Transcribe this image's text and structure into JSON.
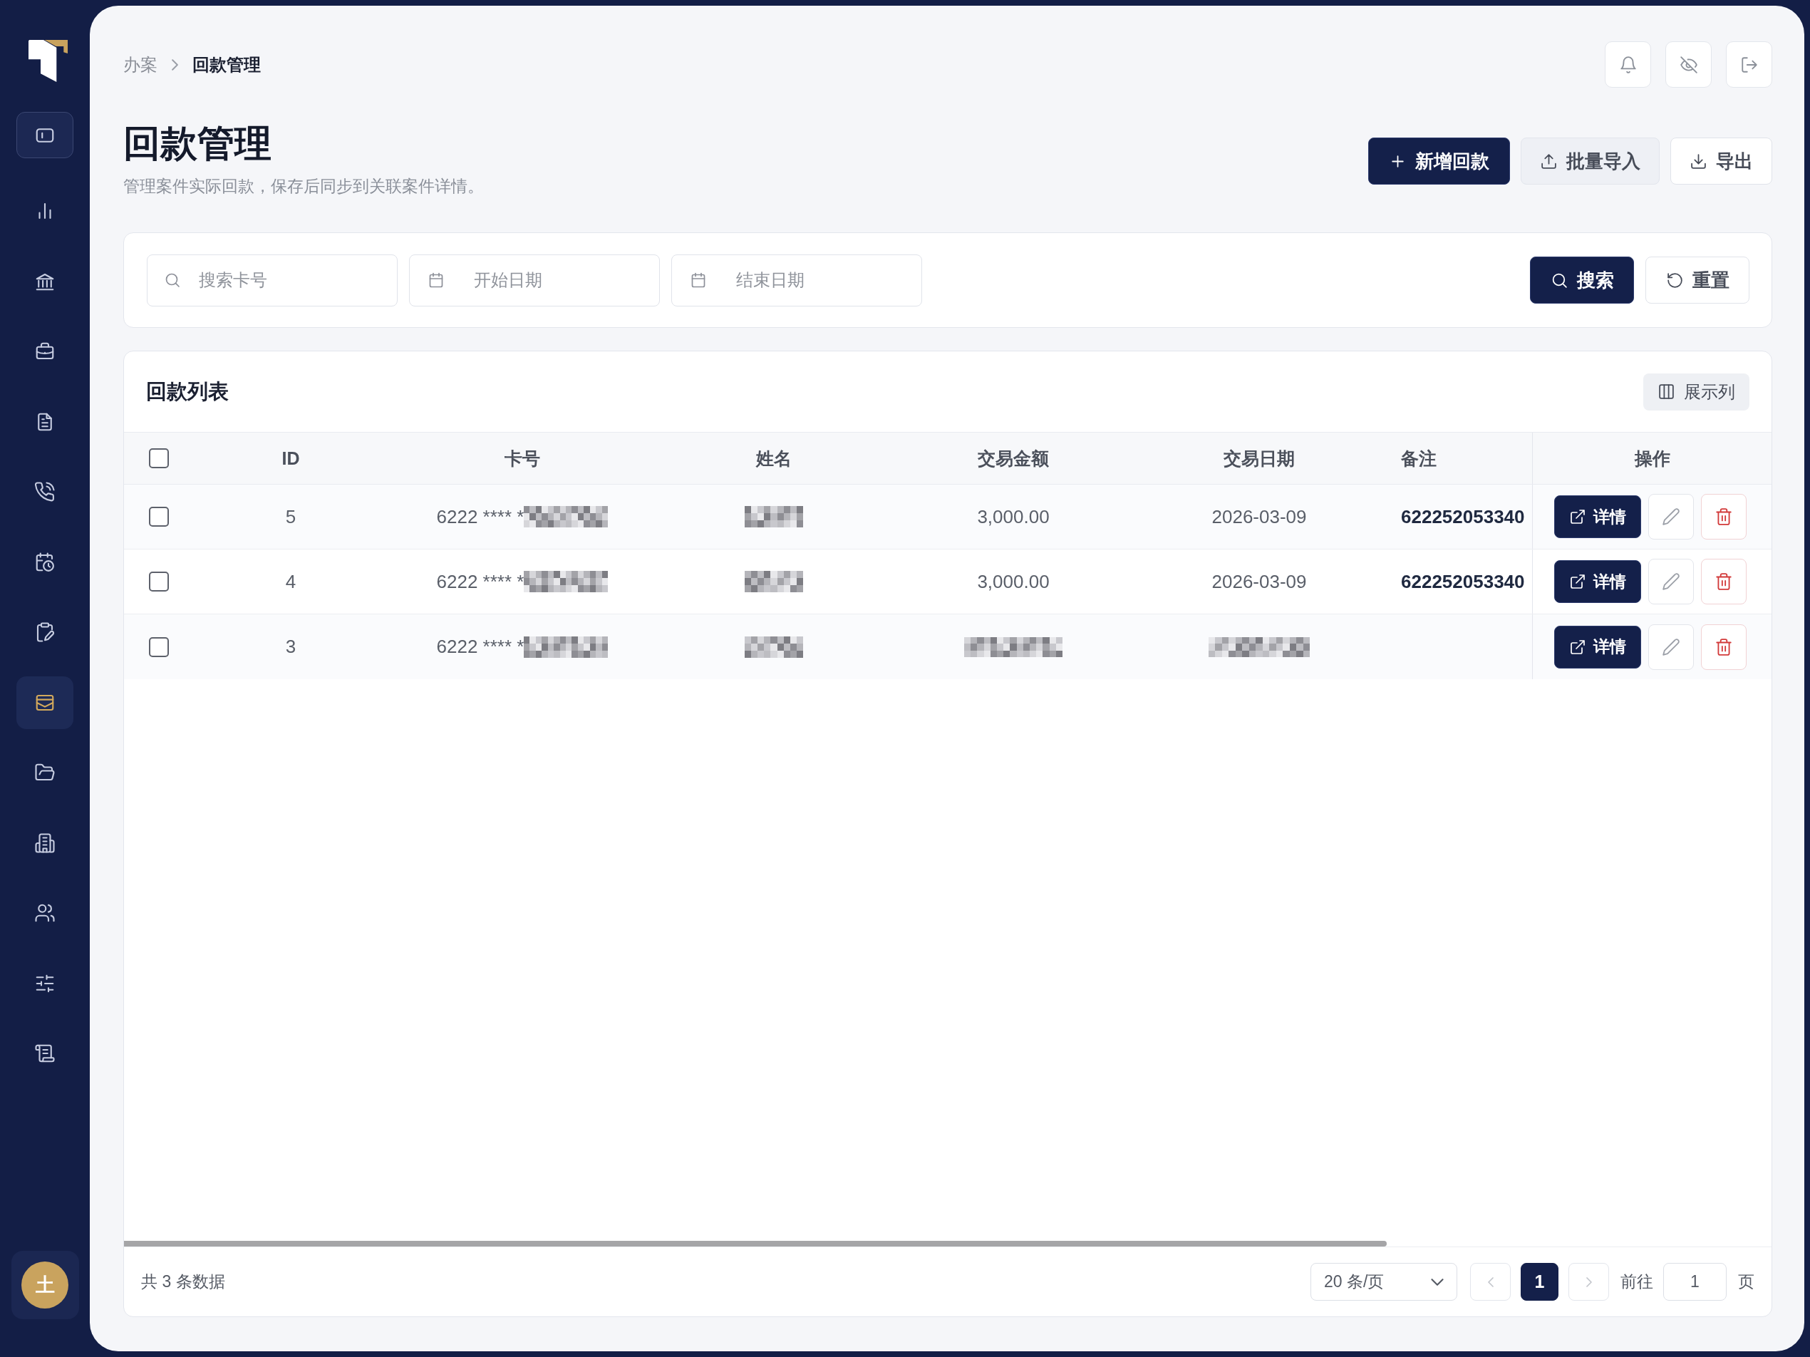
{
  "sidebar": {
    "items": [
      {
        "selected": false
      },
      {
        "selected": false
      },
      {
        "selected": false
      },
      {
        "selected": false
      },
      {
        "selected": false
      },
      {
        "selected": false
      },
      {
        "selected": false
      },
      {
        "selected": true
      },
      {
        "selected": false
      },
      {
        "selected": false
      },
      {
        "selected": false
      },
      {
        "selected": false
      },
      {
        "selected": false
      }
    ],
    "avatar": "土"
  },
  "breadcrumb": [
    {
      "label": "办案",
      "current": false
    },
    {
      "label": "回款管理",
      "current": true
    }
  ],
  "page": {
    "title": "回款管理",
    "subtitle": "管理案件实际回款，保存后同步到关联案件详情。"
  },
  "actions": [
    {
      "label": "新增回款",
      "kind": "primary"
    },
    {
      "label": "批量导入",
      "kind": "secondary"
    },
    {
      "label": "导出",
      "kind": "default"
    }
  ],
  "filters": {
    "search": {
      "placeholder": "搜索卡号"
    },
    "start_date": {
      "placeholder": "开始日期"
    },
    "end_date": {
      "placeholder": "结束日期"
    },
    "buttons": [
      {
        "label": "搜索",
        "kind": "primary"
      },
      {
        "label": "重置",
        "kind": "default"
      }
    ]
  },
  "table": {
    "title": "回款列表",
    "column_toggle": "展示列",
    "select_all": {
      "checked": false
    },
    "columns": [
      "ID",
      "卡号",
      "姓名",
      "交易金额",
      "交易日期",
      "备注",
      "操作"
    ],
    "rows": [
      {
        "checked": false,
        "id": "5",
        "card_number": "6222 **** *",
        "card_redacted": true,
        "name_redacted": true,
        "amount": "3,000.00",
        "amount_redacted": false,
        "date": "2026-03-09",
        "date_redacted": false,
        "remark": "622252053340",
        "detail_button": "详情"
      },
      {
        "checked": false,
        "id": "4",
        "card_number": "6222 **** *",
        "card_redacted": true,
        "name_redacted": true,
        "amount": "3,000.00",
        "amount_redacted": false,
        "date": "2026-03-09",
        "date_redacted": false,
        "remark": "622252053340",
        "detail_button": "详情"
      },
      {
        "checked": false,
        "id": "3",
        "card_number": "6222 **** *",
        "card_redacted": true,
        "name_redacted": true,
        "amount_redacted": true,
        "date_redacted": true,
        "detail_button": "详情"
      }
    ]
  },
  "pagination": {
    "total": "共 3 条数据",
    "page_size": "20 条/页",
    "prev": {
      "disabled": true
    },
    "pages": [
      {
        "label": "1",
        "selected": true
      }
    ],
    "next": {
      "disabled": true
    },
    "goto_label": "前往",
    "goto_value": "1",
    "goto_suffix": "页"
  }
}
